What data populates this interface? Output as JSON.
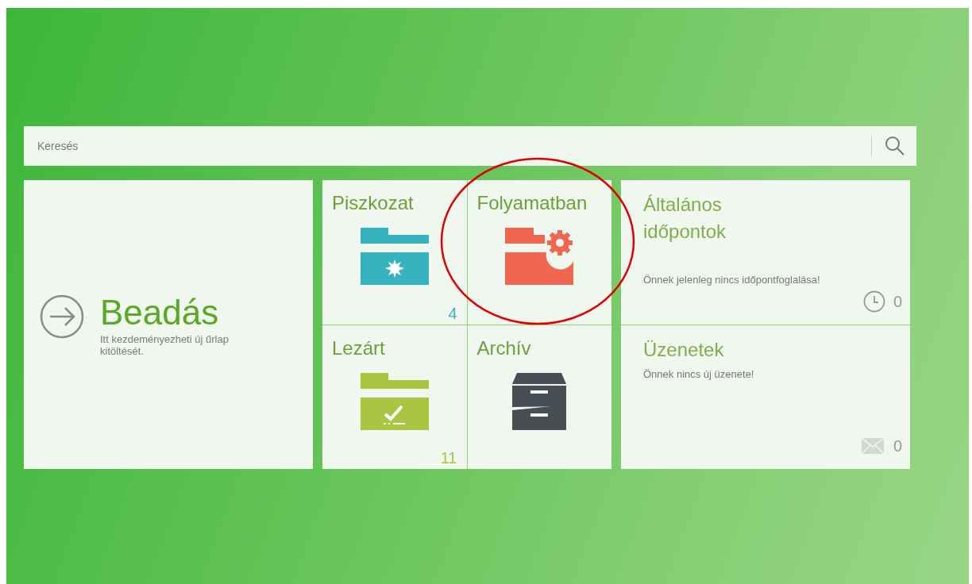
{
  "search": {
    "placeholder": "Keresés"
  },
  "submit_tile": {
    "title": "Beadás",
    "description": "Itt kezdeményezheti új űrlap kitöltését."
  },
  "folders": [
    {
      "title": "Piszkozat",
      "kind": "draft",
      "count": "4",
      "color": "#36b3bf"
    },
    {
      "title": "Folyamatban",
      "kind": "in_progress",
      "color": "#f0674f"
    },
    {
      "title": "Lezárt",
      "kind": "closed",
      "count": "11",
      "color": "#a9c542"
    },
    {
      "title": "Archív",
      "kind": "archive",
      "color": "#474f55"
    }
  ],
  "appointments": {
    "title": "Általános időpontok",
    "message": "Önnek jelenleg nincs időpontfoglalása!",
    "count": "0"
  },
  "messages": {
    "title": "Üzenetek",
    "message": "Önnek nincs új üzenete!",
    "count": "0"
  }
}
